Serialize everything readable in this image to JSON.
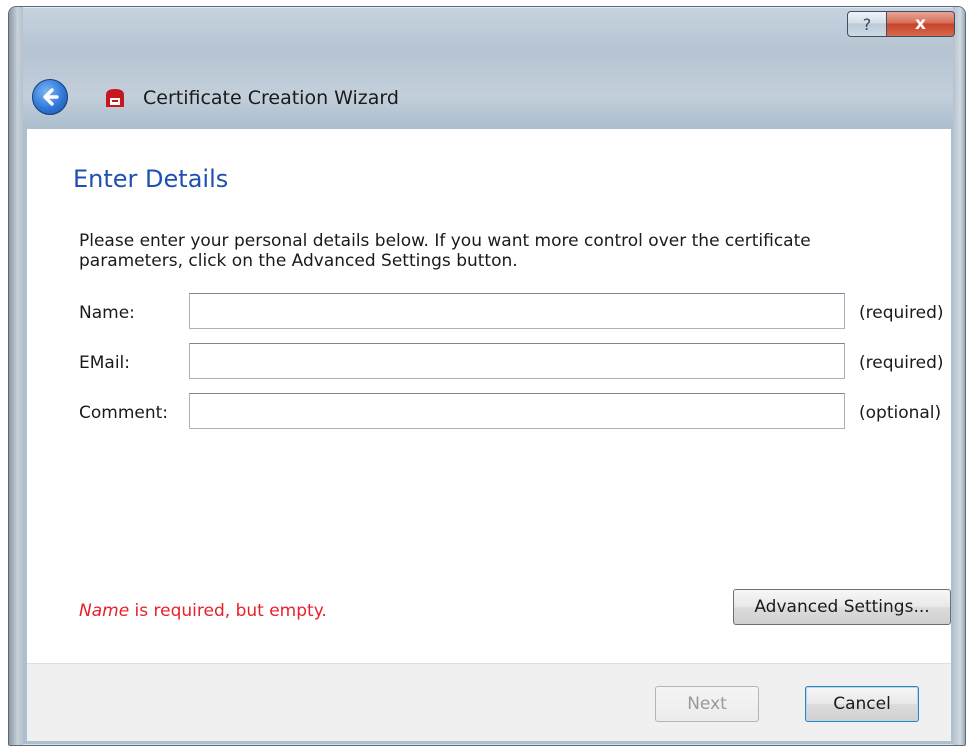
{
  "window": {
    "title": "Certificate Creation Wizard",
    "help_label": "?",
    "close_label": "x"
  },
  "page": {
    "title": "Enter Details",
    "instructions": "Please enter your personal details below. If you want more control over the certificate parameters, click on the Advanced Settings button."
  },
  "fields": [
    {
      "label": "Name:",
      "value": "",
      "hint": "(required)"
    },
    {
      "label": "EMail:",
      "value": "",
      "hint": "(required)"
    },
    {
      "label": "Comment:",
      "value": "",
      "hint": "(optional)"
    }
  ],
  "error": {
    "field": "Name",
    "message": " is required, but empty."
  },
  "buttons": {
    "advanced": "Advanced Settings...",
    "next": "Next",
    "cancel": "Cancel"
  },
  "colors": {
    "title_blue": "#1f4fb0",
    "error_red": "#e8202a",
    "close_red": "#c7432a"
  },
  "icons": {
    "back": "back-arrow-icon",
    "app": "certificate-icon",
    "help": "help-icon",
    "close": "close-icon"
  }
}
